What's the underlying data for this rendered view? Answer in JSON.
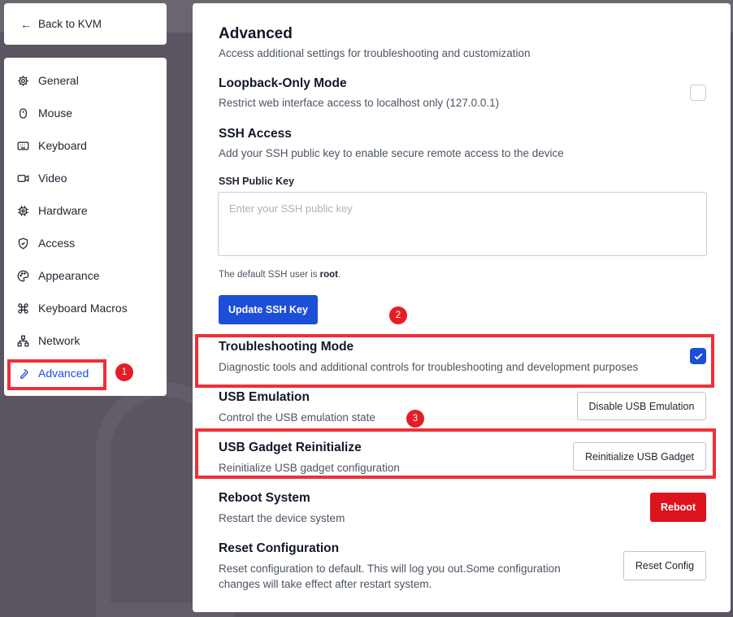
{
  "back": {
    "label": "Back to KVM"
  },
  "sidebar": {
    "items": [
      {
        "label": "General",
        "icon": "gear-icon"
      },
      {
        "label": "Mouse",
        "icon": "mouse-icon"
      },
      {
        "label": "Keyboard",
        "icon": "keyboard-icon"
      },
      {
        "label": "Video",
        "icon": "video-icon"
      },
      {
        "label": "Hardware",
        "icon": "chip-icon"
      },
      {
        "label": "Access",
        "icon": "shield-icon"
      },
      {
        "label": "Appearance",
        "icon": "palette-icon"
      },
      {
        "label": "Keyboard Macros",
        "icon": "command-icon"
      },
      {
        "label": "Network",
        "icon": "network-icon"
      },
      {
        "label": "Advanced",
        "icon": "wrench-icon",
        "active": true
      }
    ]
  },
  "page": {
    "title": "Advanced",
    "subtitle": "Access additional settings for troubleshooting and customization"
  },
  "loopback": {
    "title": "Loopback-Only Mode",
    "description": "Restrict web interface access to localhost only (127.0.0.1)",
    "checked": false
  },
  "ssh": {
    "title": "SSH Access",
    "description": "Add your SSH public key to enable secure remote access to the device",
    "field_label": "SSH Public Key",
    "placeholder": "Enter your SSH public key",
    "value": "",
    "note_prefix": "The default SSH user is ",
    "note_user": "root",
    "note_suffix": ".",
    "button_label": "Update SSH Key"
  },
  "troubleshooting": {
    "title": "Troubleshooting Mode",
    "description": "Diagnostic tools and additional controls for troubleshooting and development purposes",
    "checked": true
  },
  "usb_emulation": {
    "title": "USB Emulation",
    "description": "Control the USB emulation state",
    "button_label": "Disable USB Emulation"
  },
  "usb_gadget": {
    "title": "USB Gadget Reinitialize",
    "description": "Reinitialize USB gadget configuration",
    "button_label": "Reinitialize USB Gadget"
  },
  "reboot": {
    "title": "Reboot System",
    "description": "Restart the device system",
    "button_label": "Reboot"
  },
  "reset": {
    "title": "Reset Configuration",
    "description_line1": "Reset configuration to default. This will log you out.Some configuration",
    "description_line2": "changes will take effect after restart system.",
    "button_label": "Reset Config"
  },
  "annotations": {
    "badge1": "1",
    "badge2": "2",
    "badge3": "3"
  },
  "colors": {
    "accent": "#1d4ed8",
    "danger": "#dc141d",
    "highlight": "#ef2f37"
  }
}
